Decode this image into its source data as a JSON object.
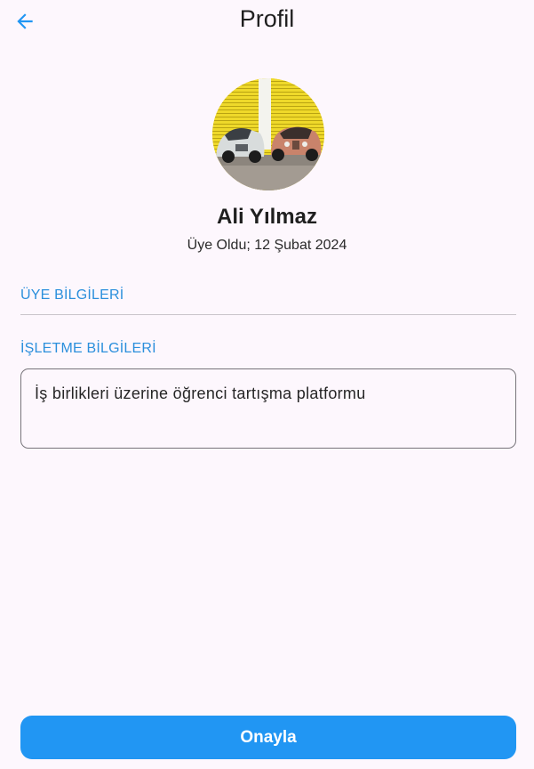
{
  "appbar": {
    "title": "Profil",
    "back_icon": "arrow-left-icon",
    "accent": "#2196f3"
  },
  "profile": {
    "name": "Ali Yılmaz",
    "member_since": "Üye Oldu; 12 Şubat 2024"
  },
  "sections": {
    "member_info_label": "ÜYE BİLGİLERİ",
    "business_info_label": "İŞLETME BİLGİLERİ",
    "business_description": "İş birlikleri üzerine öğrenci tartışma platformu"
  },
  "actions": {
    "confirm_label": "Onayla"
  },
  "colors": {
    "background": "#fdf7fd",
    "section_label": "#2b8fdc",
    "button": "#2196f3"
  }
}
